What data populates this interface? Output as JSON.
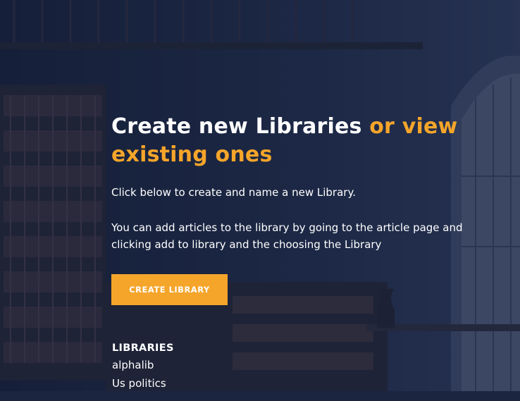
{
  "hero": {
    "headline_white": "Create new Libraries ",
    "headline_accent": "or view existing ones",
    "intro": "Click below to create and name a new Library.",
    "instructions": "You can add articles to the library by going to the article page and clicking add to library and the choosing the Library",
    "create_button_label": "CREATE LIBRARY"
  },
  "libraries": {
    "heading": "LIBRARIES",
    "items": [
      {
        "label": "alphalib"
      },
      {
        "label": "Us politics"
      }
    ]
  },
  "colors": {
    "accent": "#f5a52a",
    "overlay": "#1c2a45",
    "text": "#ffffff"
  }
}
